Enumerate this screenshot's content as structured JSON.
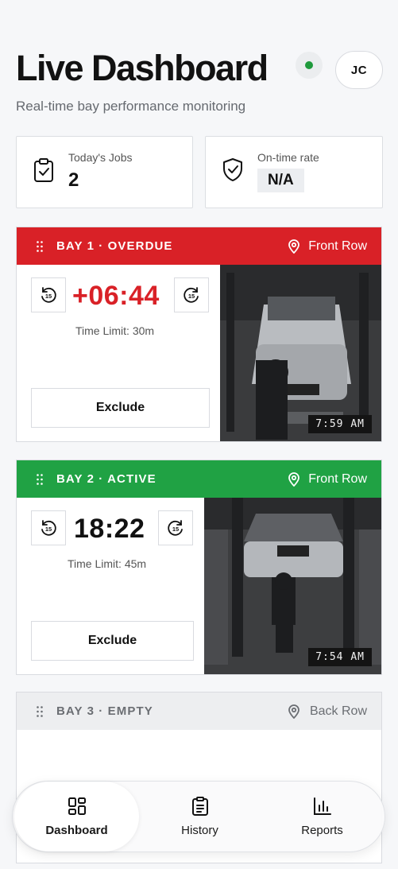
{
  "header": {
    "title": "Live Dashboard",
    "avatar_initials": "JC",
    "subtitle": "Real-time bay performance monitoring",
    "live_status_color": "#1f9a3c"
  },
  "stats": [
    {
      "label": "Today's Jobs",
      "value": "2",
      "icon": "clipboard-check-icon"
    },
    {
      "label": "On-time rate",
      "value": "N/A",
      "icon": "shield-check-icon"
    }
  ],
  "bays": [
    {
      "title": "BAY 1 · OVERDUE",
      "location": "Front Row",
      "status": "overdue",
      "status_color": "#d92127",
      "timer": "+06:44",
      "time_limit": "Time Limit: 30m",
      "exclude_label": "Exclude",
      "camera_time": "7:59 AM",
      "skip_amount": "15"
    },
    {
      "title": "BAY 2 · ACTIVE",
      "location": "Front Row",
      "status": "active",
      "status_color": "#20a244",
      "timer": "18:22",
      "time_limit": "Time Limit: 45m",
      "exclude_label": "Exclude",
      "camera_time": "7:54 AM",
      "skip_amount": "15"
    },
    {
      "title": "BAY 3 · EMPTY",
      "location": "Back Row",
      "status": "empty",
      "status_color": "#edeef0"
    }
  ],
  "nav": {
    "items": [
      {
        "label": "Dashboard",
        "icon": "dashboard-grid-icon",
        "active": true
      },
      {
        "label": "History",
        "icon": "clipboard-list-icon",
        "active": false
      },
      {
        "label": "Reports",
        "icon": "bar-chart-icon",
        "active": false
      }
    ]
  }
}
